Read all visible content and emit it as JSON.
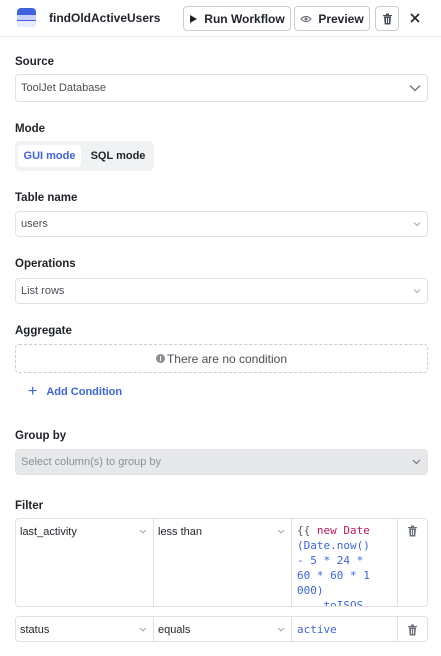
{
  "header": {
    "query_name": "findOldActiveUsers",
    "run_label": "Run Workflow",
    "preview_label": "Preview"
  },
  "source": {
    "label": "Source",
    "value": "ToolJet Database"
  },
  "mode": {
    "label": "Mode",
    "options": [
      "GUI mode",
      "SQL mode"
    ],
    "selected": "GUI mode"
  },
  "table": {
    "label": "Table name",
    "value": "users"
  },
  "operations": {
    "label": "Operations",
    "value": "List rows"
  },
  "aggregate": {
    "label": "Aggregate",
    "empty_text": "There are no condition",
    "add_label": "Add Condition"
  },
  "group_by": {
    "label": "Group by",
    "placeholder": "Select column(s) to group by"
  },
  "filter": {
    "label": "Filter",
    "rows": [
      {
        "column": "last_activity",
        "operator": "less than",
        "value_lines": [
          "{{ new Date",
          "(Date.now()",
          "- 5 * 24 *",
          "60 * 60 * 1",
          "000)",
          "   .toISOS"
        ]
      },
      {
        "column": "status",
        "operator": "equals",
        "value": "active"
      }
    ]
  },
  "colors": {
    "accent": "#3e63dd",
    "border": "#dfe1e4",
    "disabled_bg": "#e7e8ea",
    "keyword": "#c2185b"
  },
  "icons": {
    "query": "tooljet-db-icon",
    "run": "play-icon",
    "preview": "eye-icon",
    "delete": "trash-icon",
    "close": "close-icon",
    "dropdown": "chevron-down-icon",
    "info": "info-icon",
    "add": "plus-icon"
  }
}
